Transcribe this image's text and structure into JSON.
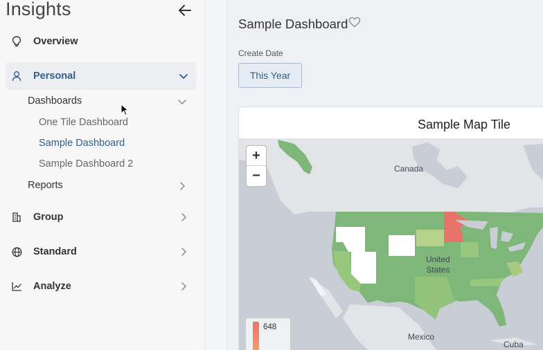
{
  "sidebar": {
    "title": "Insights",
    "items": [
      {
        "label": "Overview",
        "icon": "bulb-icon"
      },
      {
        "label": "Personal",
        "icon": "person-icon",
        "expanded": true
      },
      {
        "label": "Group",
        "icon": "building-icon"
      },
      {
        "label": "Standard",
        "icon": "globe-icon"
      },
      {
        "label": "Analyze",
        "icon": "chart-line-icon"
      }
    ],
    "personal": {
      "dashboards_label": "Dashboards",
      "dashboards": [
        "One Tile Dashboard",
        "Sample Dashboard",
        "Sample Dashboard 2"
      ],
      "reports_label": "Reports"
    }
  },
  "main": {
    "title": "Sample Dashboard",
    "filter": {
      "label": "Create Date",
      "value": "This Year"
    },
    "tile": {
      "title": "Sample Map Tile",
      "zoom_in": "+",
      "zoom_out": "−",
      "legend_max": "648",
      "map_labels": {
        "canada": "Canada",
        "us": "United\nStates",
        "mexico": "Mexico",
        "cuba": "Cuba"
      }
    }
  },
  "colors": {
    "accent": "#2f5f8c",
    "map_green": "#7fb77a",
    "map_red": "#e8736a"
  }
}
